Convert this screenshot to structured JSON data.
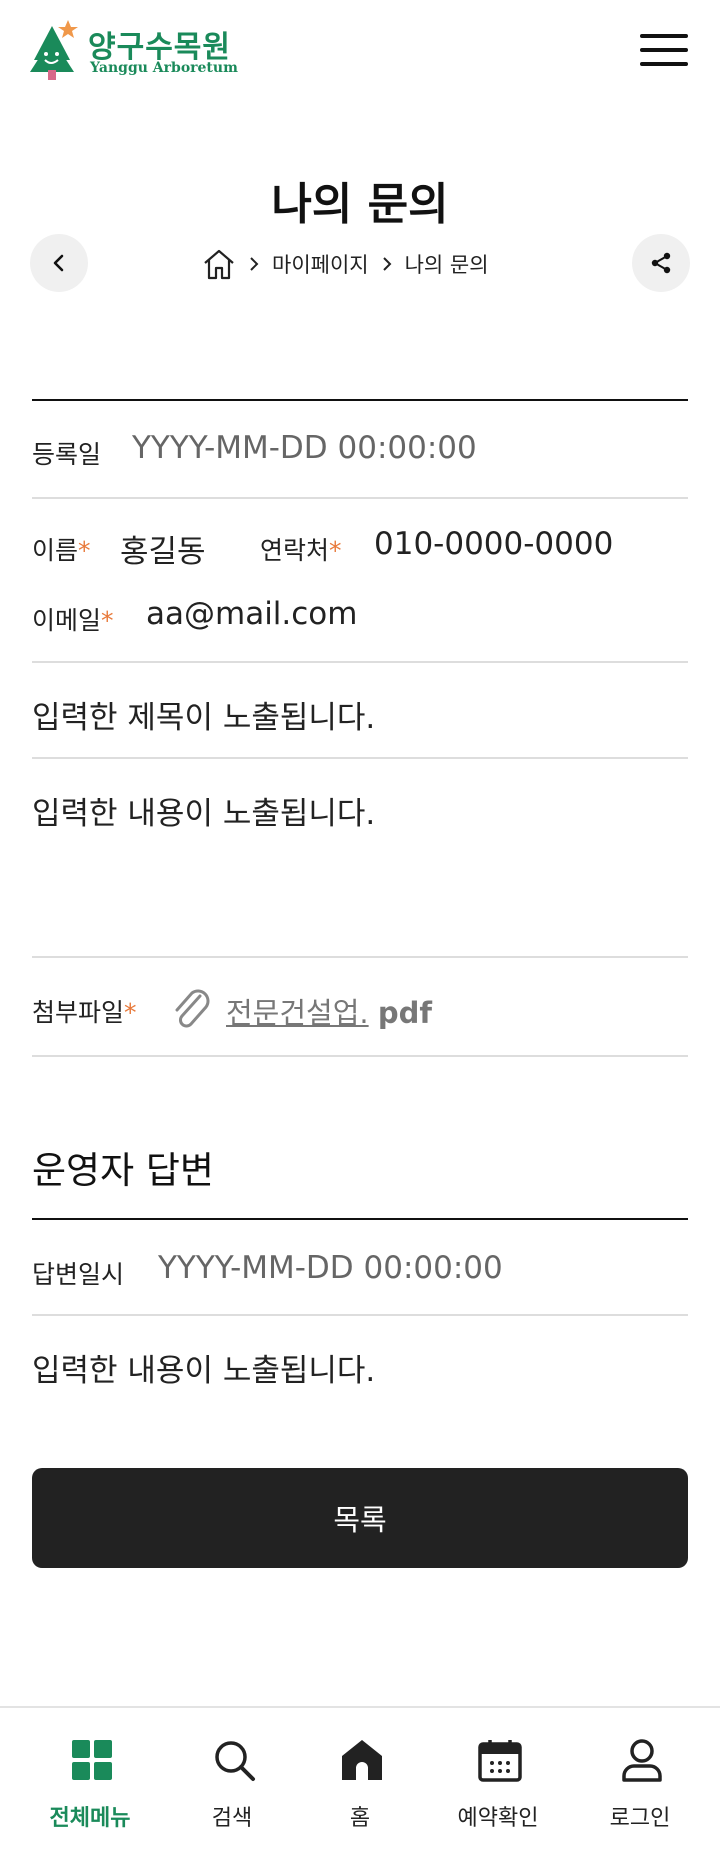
{
  "header": {
    "logo_ko": "양구수목원",
    "logo_en": "Yanggu Arboretum",
    "menu_icon": "hamburger-menu-icon"
  },
  "page": {
    "title": "나의 문의",
    "back_icon": "chevron-left-icon",
    "share_icon": "share-icon"
  },
  "breadcrumb": {
    "home_icon": "home-icon",
    "items": [
      "마이페이지",
      "나의 문의"
    ]
  },
  "inquiry": {
    "registered_label": "등록일",
    "registered_value": "YYYY-MM-DD 00:00:00",
    "name_label": "이름",
    "name_value": "홍길동",
    "contact_label": "연락처",
    "contact_value": "010-0000-0000",
    "email_label": "이메일",
    "email_value": "aa@mail.com",
    "required_mark": "*",
    "subject": "입력한 제목이 노출됩니다.",
    "content": "입력한 내용이 노출됩니다.",
    "attachment_label": "첨부파일",
    "attachment_name": "전문건설업.",
    "attachment_ext": "pdf",
    "attachment_icon": "paperclip-icon"
  },
  "answer": {
    "section_title": "운영자 답변",
    "date_label": "답변일시",
    "date_value": "YYYY-MM-DD 00:00:00",
    "content": "입력한 내용이 노출됩니다."
  },
  "actions": {
    "list_label": "목록"
  },
  "bottom_nav": {
    "active_color": "#1a8a5a",
    "items": [
      {
        "label": "전체메뉴",
        "icon": "grid-icon",
        "active": true
      },
      {
        "label": "검색",
        "icon": "search-icon",
        "active": false
      },
      {
        "label": "홈",
        "icon": "home-icon",
        "active": false
      },
      {
        "label": "예약확인",
        "icon": "calendar-icon",
        "active": false
      },
      {
        "label": "로그인",
        "icon": "user-icon",
        "active": false
      }
    ]
  }
}
